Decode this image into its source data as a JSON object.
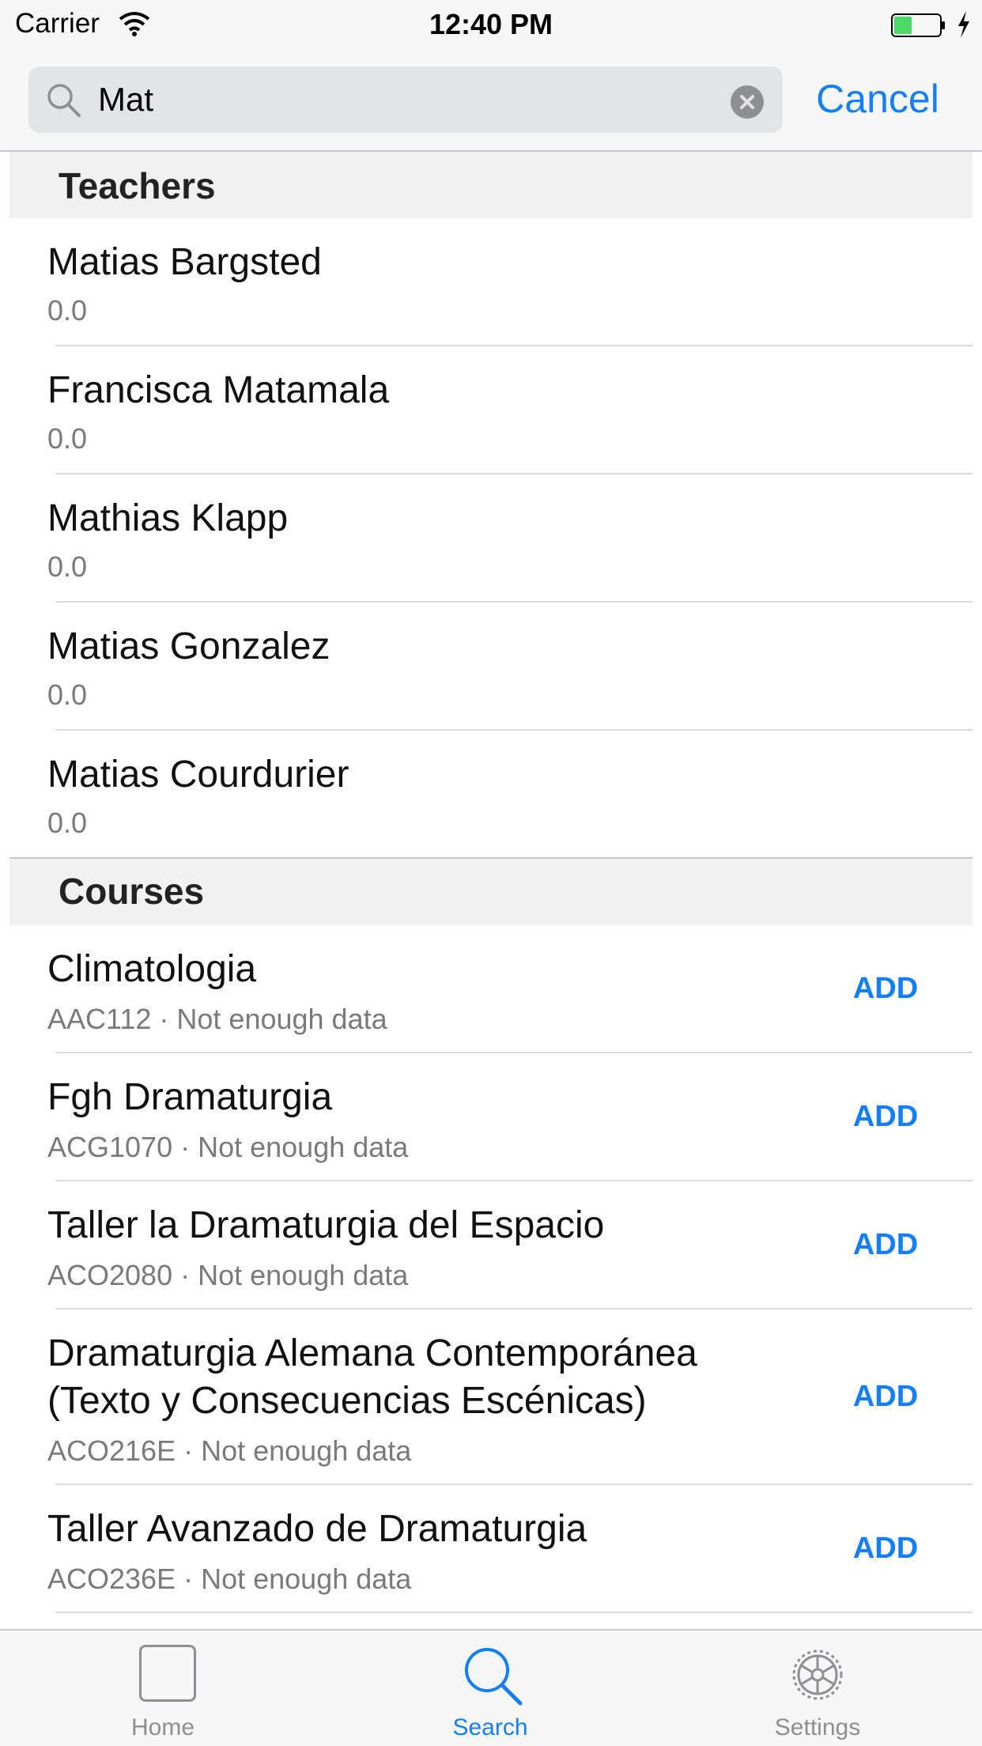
{
  "status_bar": {
    "carrier": "Carrier",
    "time": "12:40 PM"
  },
  "search": {
    "value": "Mat",
    "cancel_label": "Cancel"
  },
  "sections": {
    "teachers": {
      "title": "Teachers",
      "rows": [
        {
          "name": "Matias Bargsted",
          "rating": "0.0"
        },
        {
          "name": "Francisca Matamala",
          "rating": "0.0"
        },
        {
          "name": "Mathias Klapp",
          "rating": "0.0"
        },
        {
          "name": "Matias Gonzalez",
          "rating": "0.0"
        },
        {
          "name": "Matias Courdurier",
          "rating": "0.0"
        }
      ]
    },
    "courses": {
      "title": "Courses",
      "add_label": "ADD",
      "rows": [
        {
          "title": "Climatologia",
          "subtitle": "AAC112 · Not enough data"
        },
        {
          "title": "Fgh Dramaturgia",
          "subtitle": "ACG1070 · Not enough data"
        },
        {
          "title": "Taller la Dramaturgia del Espacio",
          "subtitle": "ACO2080 · Not enough data"
        },
        {
          "title_line1": "Dramaturgia Alemana Contemporánea",
          "title_line2": "(Texto y Consecuencias Escénicas)",
          "subtitle": "ACO216E · Not enough data"
        },
        {
          "title": "Taller Avanzado de Dramaturgia",
          "subtitle": "ACO236E · Not enough data"
        }
      ]
    }
  },
  "tab_bar": {
    "tabs": [
      {
        "label": "Home",
        "icon": "home-icon",
        "active": false
      },
      {
        "label": "Search",
        "icon": "search-icon",
        "active": true
      },
      {
        "label": "Settings",
        "icon": "gear-icon",
        "active": false
      }
    ]
  },
  "colors": {
    "accent": "#147efb",
    "inactive": "#8e8e93",
    "battery": "#4cd964"
  }
}
